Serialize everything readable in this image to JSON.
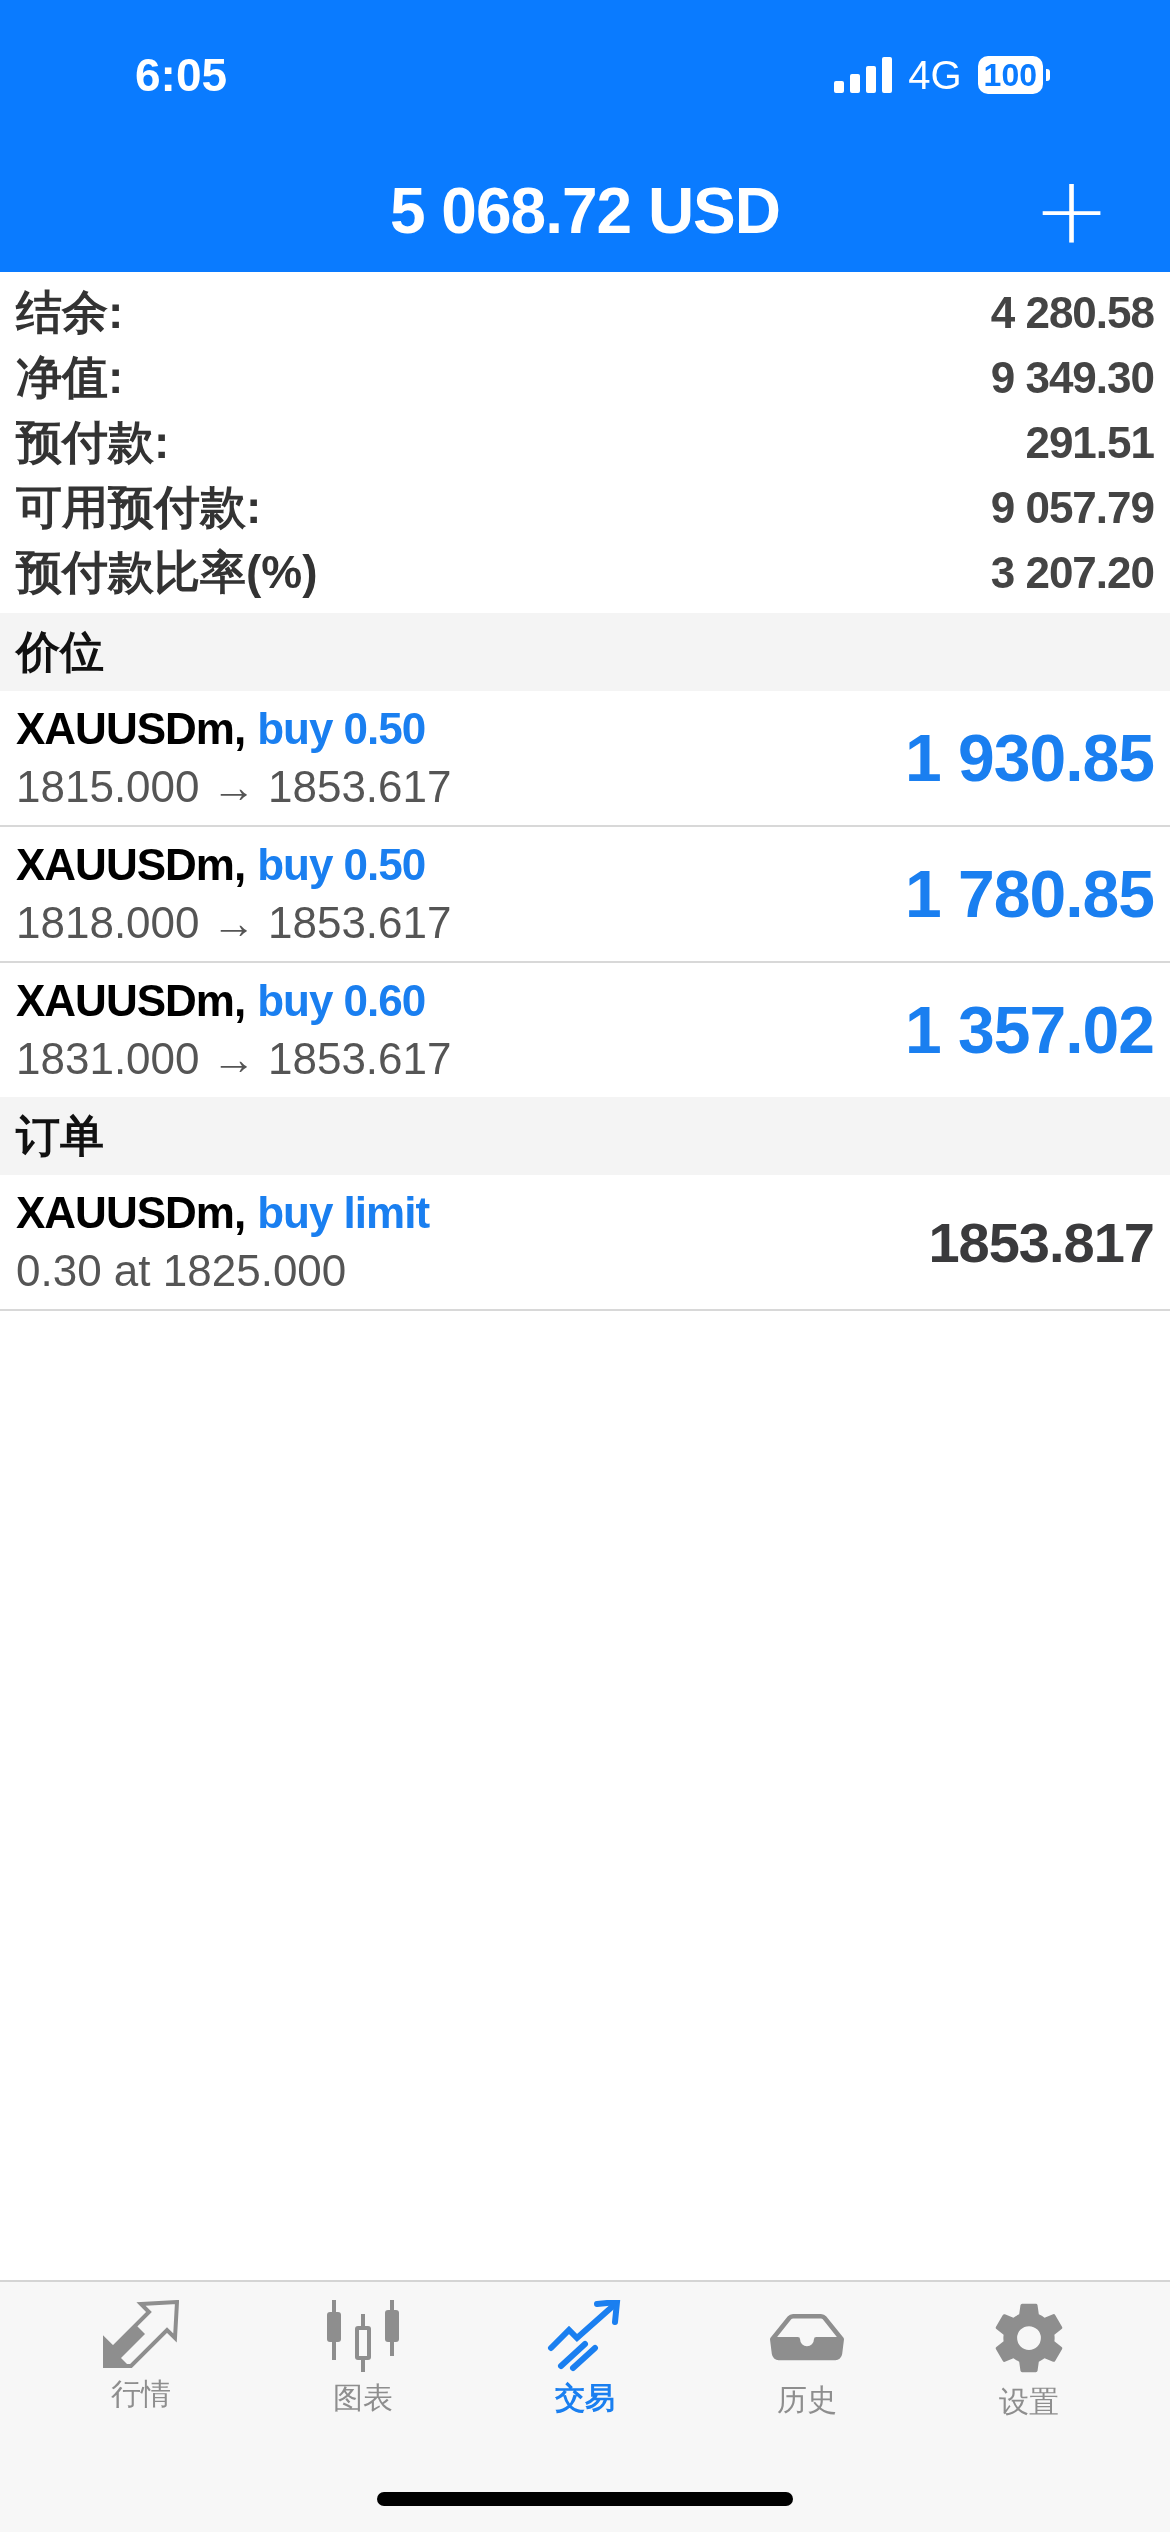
{
  "status_bar": {
    "time": "6:05",
    "network": "4G",
    "battery": "100"
  },
  "header": {
    "title": "5 068.72 USD",
    "add_button": "+"
  },
  "summary": [
    {
      "label": "结余:",
      "value": "4 280.58"
    },
    {
      "label": "净值:",
      "value": "9 349.30"
    },
    {
      "label": "预付款:",
      "value": "291.51"
    },
    {
      "label": "可用预付款:",
      "value": "9 057.79"
    },
    {
      "label": "预付款比率(%)",
      "value": "3 207.20"
    }
  ],
  "sections": [
    {
      "title": "价位",
      "items": [
        {
          "kind": "position",
          "symbol": "XAUUSDm,",
          "action": "buy 0.50",
          "detail": "1815.000 → 1853.617",
          "amount": "1 930.85"
        },
        {
          "kind": "position",
          "symbol": "XAUUSDm,",
          "action": "buy 0.50",
          "detail": "1818.000 → 1853.617",
          "amount": "1 780.85"
        },
        {
          "kind": "position",
          "symbol": "XAUUSDm,",
          "action": "buy 0.60",
          "detail": "1831.000 → 1853.617",
          "amount": "1 357.02"
        }
      ]
    },
    {
      "title": "订单",
      "items": [
        {
          "kind": "order",
          "symbol": "XAUUSDm,",
          "action": "buy limit",
          "detail": "0.30 at 1825.000",
          "amount": "1853.817"
        }
      ]
    }
  ],
  "tabs": [
    {
      "kind": "quotes",
      "label": "行情",
      "selected": false
    },
    {
      "kind": "chart",
      "label": "图表",
      "selected": false
    },
    {
      "kind": "trade",
      "label": "交易",
      "selected": true
    },
    {
      "kind": "history",
      "label": "历史",
      "selected": false
    },
    {
      "kind": "settings",
      "label": "设置",
      "selected": false
    }
  ]
}
